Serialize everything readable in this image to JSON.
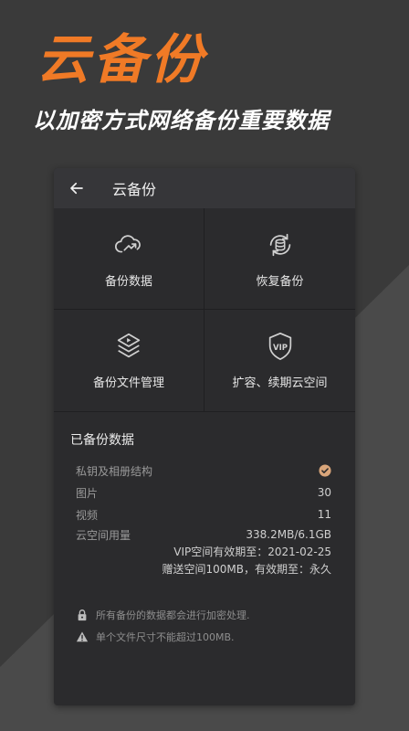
{
  "hero": {
    "title": "云备份",
    "subtitle": "以加密方式网络备份重要数据"
  },
  "appbar": {
    "title": "云备份",
    "back_icon": "arrow-left-icon"
  },
  "grid": [
    {
      "label": "备份数据",
      "icon": "cloud-upload-icon"
    },
    {
      "label": "恢复备份",
      "icon": "database-restore-icon"
    },
    {
      "label": "备份文件管理",
      "icon": "layers-play-icon"
    },
    {
      "label": "扩容、续期云空间",
      "icon": "vip-shield-icon"
    }
  ],
  "backup_section": {
    "title": "已备份数据",
    "rows": [
      {
        "label": "私钥及相册结构",
        "value": ""
      },
      {
        "label": "图片",
        "value": "30"
      },
      {
        "label": "视频",
        "value": "11"
      }
    ],
    "usage": {
      "label": "云空间用量",
      "value": "338.2MB/6.1GB",
      "vip_expiry": "VIP空间有效期至：2021-02-25",
      "gift": "赠送空间100MB，有效期至：永久"
    }
  },
  "notes": [
    {
      "icon": "lock-icon",
      "text": "所有备份的数据都会进行加密处理."
    },
    {
      "icon": "warning-icon",
      "text": "单个文件尺寸不能超过100MB."
    }
  ],
  "colors": {
    "accent": "#f07a26",
    "check": "#d9a57a",
    "background": "#3a3a3a",
    "panel": "#2b2b2d"
  }
}
